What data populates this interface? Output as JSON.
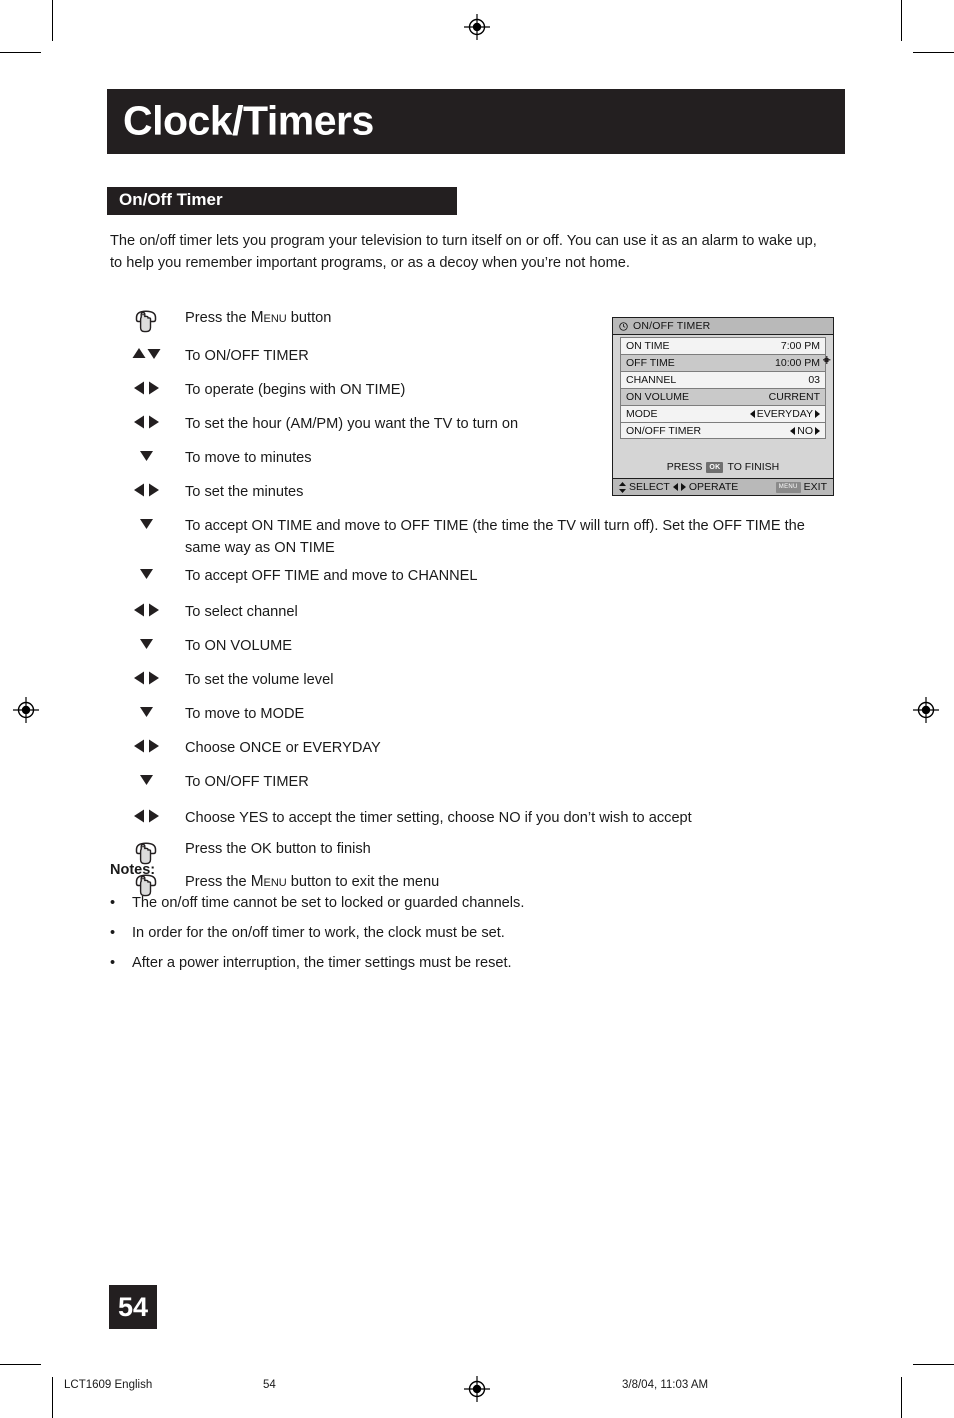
{
  "document": {
    "page_title": "Clock/Timers",
    "section_title": "On/Off Timer",
    "intro": "The on/off timer lets you program your television to turn itself on or off. You can use it as an alarm to wake up, to help you remember important programs, or as a decoy when you’re not home.",
    "page_number": "54"
  },
  "steps": [
    {
      "icon": "hand-press-icon",
      "text_pre": "Press the ",
      "text_smallcaps": "Menu",
      "text_post": " button"
    },
    {
      "icon": "up-down-arrows-icon",
      "text": "To ON/OFF TIMER"
    },
    {
      "icon": "left-right-arrows-icon",
      "text": "To operate (begins with ON TIME)"
    },
    {
      "icon": "left-right-arrows-icon",
      "text": "To set the hour (AM/PM) you want the TV to turn on"
    },
    {
      "icon": "down-arrow-icon",
      "text": "To move to minutes"
    },
    {
      "icon": "left-right-arrows-icon",
      "text": "To set the minutes"
    },
    {
      "icon": "down-arrow-icon",
      "text": "To accept ON TIME and move to OFF TIME (the time the TV will turn off). Set the OFF TIME the same way as ON TIME"
    },
    {
      "icon": "down-arrow-icon",
      "text": "To accept OFF TIME and move to CHANNEL"
    },
    {
      "icon": "left-right-arrows-icon",
      "text": "To select channel"
    },
    {
      "icon": "down-arrow-icon",
      "text": "To ON VOLUME"
    },
    {
      "icon": "left-right-arrows-icon",
      "text": "To set the volume level"
    },
    {
      "icon": "down-arrow-icon",
      "text": "To move to MODE"
    },
    {
      "icon": "left-right-arrows-icon",
      "text": "Choose ONCE or EVERYDAY"
    },
    {
      "icon": "down-arrow-icon",
      "text": "To ON/OFF TIMER"
    },
    {
      "icon": "left-right-arrows-icon",
      "text": "Choose YES to accept the timer setting, choose NO if you don’t wish to accept"
    },
    {
      "icon": "hand-press-icon",
      "text": "Press the OK button to finish"
    },
    {
      "icon": "hand-press-icon",
      "text_pre": "Press the ",
      "text_smallcaps": "Menu",
      "text_post": " button to exit the menu"
    }
  ],
  "notes": {
    "heading": "Notes:",
    "bullet": "•",
    "items": [
      "The on/off time cannot be set to locked or guarded channels.",
      "In order for the on/off timer to work, the clock must be set.",
      "After a power interruption, the timer settings must be reset."
    ]
  },
  "osd": {
    "title": "ON/OFF TIMER",
    "title_icon": "clock-icon",
    "rows": [
      {
        "label": "ON TIME",
        "value": "7:00 PM",
        "shade": "light",
        "arrows": false
      },
      {
        "label": "OFF TIME",
        "value": "10:00 PM",
        "shade": "dark",
        "arrows": false
      },
      {
        "label": "CHANNEL",
        "value": "03",
        "shade": "light",
        "arrows": false
      },
      {
        "label": "ON VOLUME",
        "value": "CURRENT",
        "shade": "dark",
        "arrows": false
      },
      {
        "label": "MODE",
        "value": "EVERYDAY",
        "shade": "light",
        "arrows": true
      },
      {
        "label": "ON/OFF TIMER",
        "value": "NO",
        "shade": "light",
        "arrows": true
      }
    ],
    "press_pre": "PRESS",
    "press_chip": "OK",
    "press_post": "TO FINISH",
    "foot_select": "SELECT",
    "foot_operate": "OPERATE",
    "foot_menu_chip": "MENU",
    "foot_exit": "EXIT"
  },
  "footer": {
    "left": "LCT1609 English",
    "page": "54",
    "right": "3/8/04, 11:03 AM"
  },
  "colors": {
    "ink": "#231f20",
    "paper": "#ffffff",
    "osd_panel": "#d5d5d5",
    "osd_bar": "#b9b9b9",
    "osd_row_light": "#f3f3f3",
    "osd_row_dark": "#c9c9c9"
  }
}
